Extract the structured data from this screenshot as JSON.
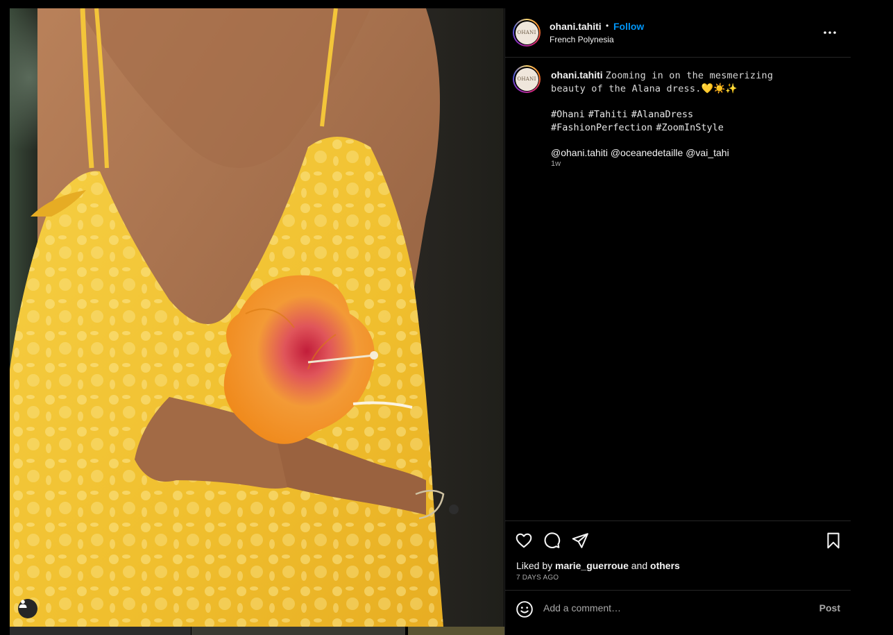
{
  "media": {
    "description_icon": "user-tag-icon",
    "colors": {
      "dress": "#f1c232",
      "flower": "#f5a02a",
      "skin": "#a8734f"
    }
  },
  "post": {
    "header": {
      "username": "ohani.tahiti",
      "separator": "•",
      "follow_label": "Follow",
      "location": "French Polynesia",
      "avatar_text": "OHANI"
    },
    "caption": {
      "username": "ohani.tahiti",
      "text": "Zooming in on the mesmerizing beauty of the Alana dress.",
      "emojis": "💛☀️✨",
      "hashtags": [
        "#Ohani",
        "#Tahiti",
        "#AlanaDress",
        "#FashionPerfection",
        "#ZoomInStyle"
      ],
      "mentions": "@ohani.tahiti @oceanedetaille @vai_tahi",
      "time": "1w"
    },
    "actions": {
      "liked_by_prefix": "Liked by",
      "liked_by_user": "marie_guerroue",
      "liked_and": "and",
      "liked_others": "others",
      "date": "7 DAYS AGO"
    },
    "comment": {
      "placeholder": "Add a comment…",
      "post_label": "Post"
    }
  },
  "colors": {
    "accent": "#0095f6",
    "border": "#262626",
    "muted": "#a8a8a8"
  }
}
